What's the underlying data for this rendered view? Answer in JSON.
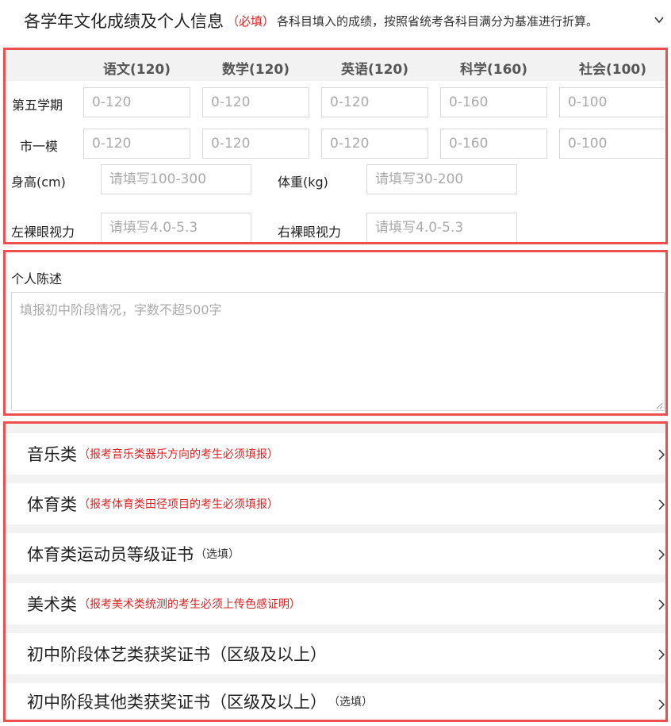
{
  "header": {
    "title": "各学年文化成绩及个人信息",
    "required": "（必填）",
    "description": "各科目填入的成绩，按照省统考各科目满分为基准进行折算。"
  },
  "grades": {
    "columns": [
      "语文(120)",
      "数学(120)",
      "英语(120)",
      "科学(160)",
      "社会(100)"
    ],
    "rows": [
      {
        "label": "第五学期",
        "placeholders": [
          "0-120",
          "0-120",
          "0-120",
          "0-160",
          "0-100"
        ]
      },
      {
        "label": "市一模",
        "placeholders": [
          "0-120",
          "0-120",
          "0-120",
          "0-160",
          "0-100"
        ]
      }
    ]
  },
  "body": {
    "height_label": "身高(cm)",
    "height_placeholder": "请填写100-300",
    "weight_label": "体重(kg)",
    "weight_placeholder": "请填写30-200",
    "left_eye_label": "左裸眼视力",
    "left_eye_placeholder": "请填写4.0-5.3",
    "right_eye_label": "右裸眼视力",
    "right_eye_placeholder": "请填写4.0-5.3"
  },
  "statement": {
    "label": "个人陈述",
    "placeholder": "填报初中阶段情况，字数不超500字"
  },
  "categories": [
    {
      "name": "音乐类",
      "note": "（报考音乐类器乐方向的考生必须填报）",
      "note_style": "red"
    },
    {
      "name": "体育类",
      "note": "（报考体育类田径项目的考生必须填报）",
      "note_style": "red"
    },
    {
      "name": "体育类运动员等级证书",
      "note": "（选填）",
      "note_style": "gray"
    },
    {
      "name": "美术类",
      "note": "（报考美术类统测的考生必须上传色感证明）",
      "note_style": "red"
    },
    {
      "name": "初中阶段体艺类获奖证书（区级及以上）",
      "note": "",
      "note_style": "gray"
    },
    {
      "name": "初中阶段其他类获奖证书（区级及以上）",
      "note": "（选填）",
      "note_style": "gray"
    }
  ],
  "colors": {
    "accent_red": "#e02020",
    "border_red": "#ee4e4e",
    "input_border": "#d9d9d9"
  }
}
